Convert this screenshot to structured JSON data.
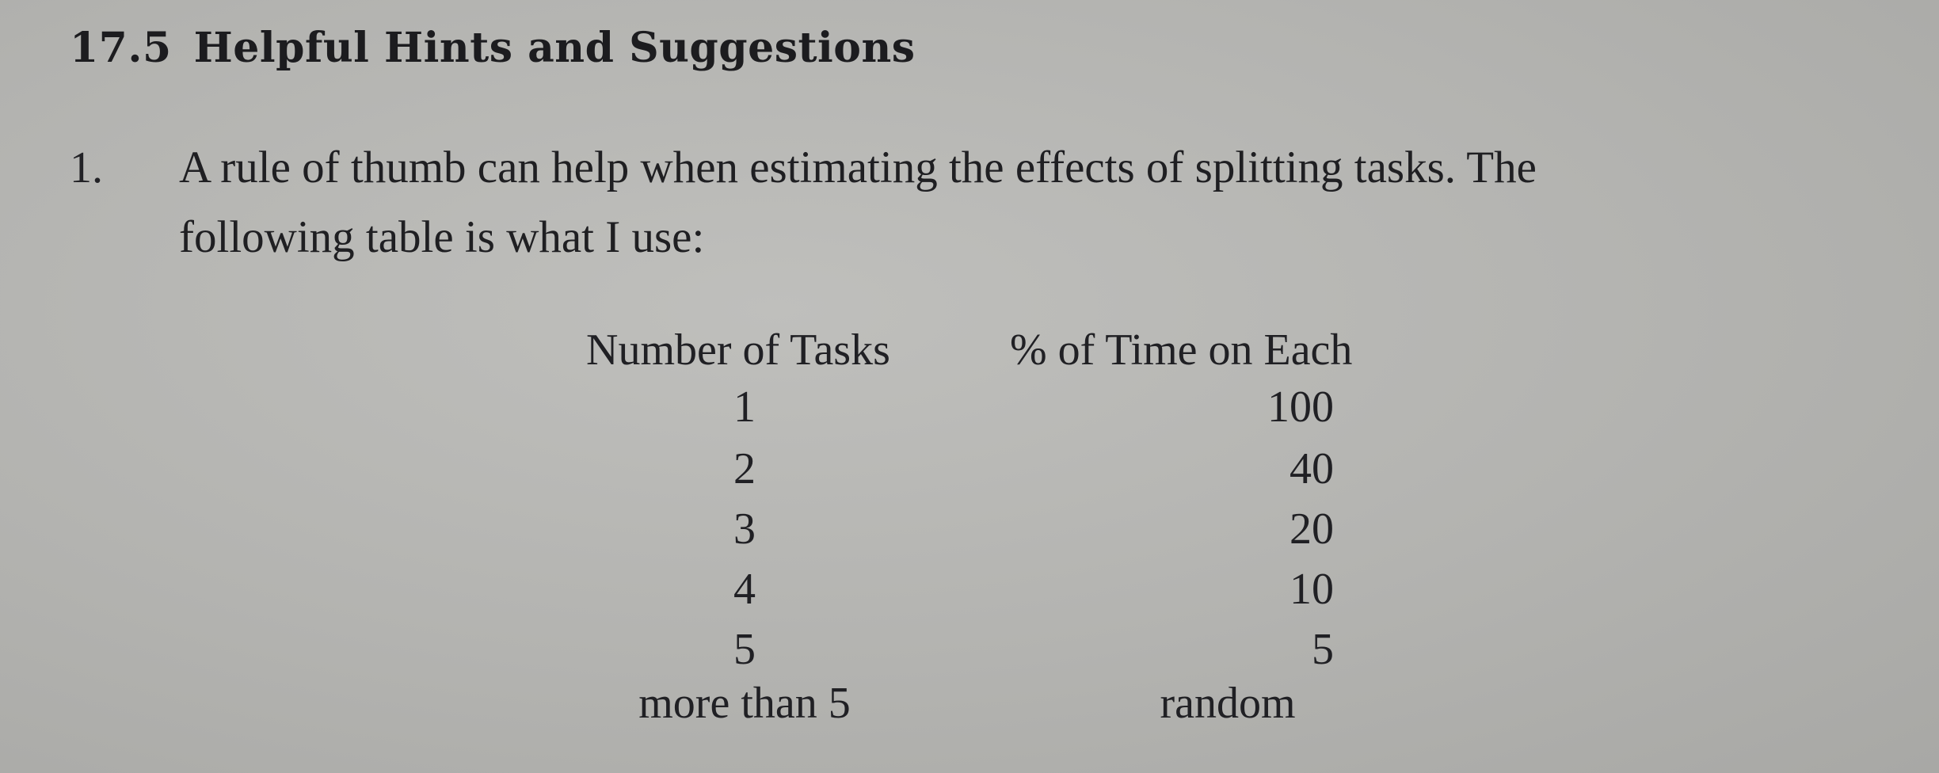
{
  "section": {
    "number": "17.5",
    "title": "Helpful Hints and Suggestions"
  },
  "item": {
    "number": "1.",
    "line1": "A rule of thumb can help when estimating the effects of splitting tasks. The",
    "line2": "following table is what I use:"
  },
  "table": {
    "headers": [
      "Number of Tasks",
      "% of Time on Each"
    ],
    "rows": [
      {
        "tasks": "1",
        "time": "100"
      },
      {
        "tasks": "2",
        "time": "40"
      },
      {
        "tasks": "3",
        "time": "20"
      },
      {
        "tasks": "4",
        "time": "10"
      },
      {
        "tasks": "5",
        "time": "5"
      },
      {
        "tasks": "more than 5",
        "time": "random"
      }
    ]
  }
}
